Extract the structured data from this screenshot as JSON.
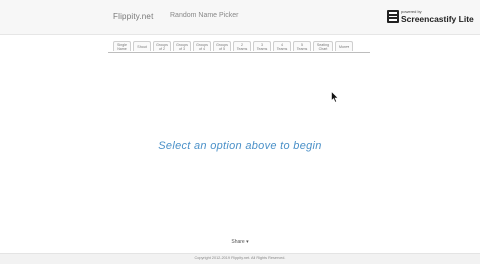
{
  "navbar": {
    "brand": "Flippity.net",
    "title": "Random Name Picker"
  },
  "recorder": {
    "powered_by": "powered by",
    "name": "Screencastify Lite"
  },
  "tabs": [
    "Single\nName",
    "Shout",
    "Groups\nof 2",
    "Groups\nof 3",
    "Groups\nof 4",
    "Groups\nof 5",
    "2\nTeams",
    "3\nTeams",
    "4\nTeams",
    "5\nTeams",
    "Seating\nChart",
    "More▾"
  ],
  "main": {
    "prompt": "Select an option above to begin"
  },
  "share": {
    "label": "Share ▾"
  },
  "footer": {
    "copyright": "Copyright 2012-2019 Flippity.net. All Rights Reserved."
  },
  "icons": {
    "recorder": "film-reel-icon",
    "cursor": "mouse-pointer-icon"
  }
}
